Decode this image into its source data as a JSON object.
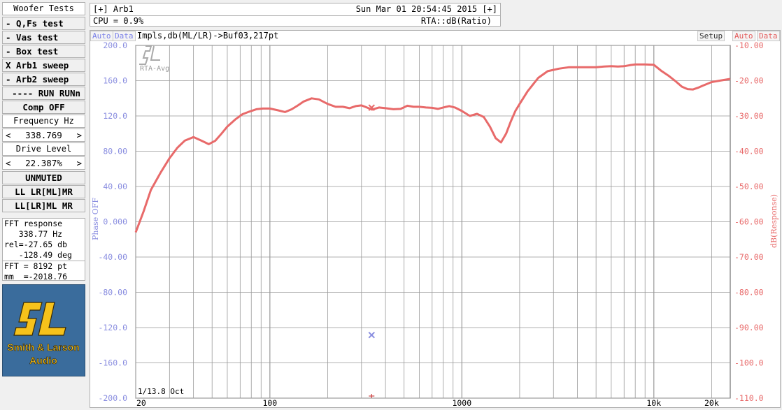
{
  "panel": {
    "title": "Woofer Tests",
    "buttons": [
      "- Q,Fs test",
      "- Vas test",
      "- Box test",
      "X Arb1 sweep",
      "- Arb2 sweep",
      "---- RUN RUNn",
      "Comp OFF"
    ],
    "frequency": {
      "label": "Frequency Hz",
      "left": "<",
      "value": "338.769",
      "right": ">"
    },
    "drive": {
      "label": "Drive Level",
      "left": "<",
      "value": "22.387%",
      "right": ">"
    },
    "mute": "UNMUTED",
    "chan1": "LL LR[ML]MR",
    "chan2": "LL[LR]ML MR"
  },
  "fft": {
    "line1": "FFT response",
    "line2": "   338.77 Hz",
    "line3": "rel=-27.65 db",
    "line4": "   -128.49 deg",
    "line5": "FFT = 8192 pt",
    "line6": "mm  =-2018.76"
  },
  "logo": {
    "mark": "SL",
    "line1": "Smith & Larson",
    "line2": "Audio"
  },
  "header": {
    "channel": "[+] Arb1",
    "datetime": "Sun Mar 01 20:54:45 2015 [+]",
    "cpu": "CPU = 0.9%",
    "mode": "RTA::dB(Ratio)"
  },
  "chart": {
    "left_auto": "Auto",
    "left_data": "Data",
    "right_auto": "Auto",
    "right_data": "Data",
    "setup": "Setup",
    "buffer_label": "Impls,db(ML/LR)->Buf03,217pt",
    "watermark": "RTA-Avg",
    "smoothing": "1/13.8 Oct",
    "left_axis_title": "Phase OFF",
    "right_axis_title": "dB(Response)",
    "colors": {
      "response": "#e86a6a",
      "phase_axis": "#8a8ee0",
      "grid": "#999999"
    }
  },
  "chart_data": {
    "type": "line",
    "x_scale": "log",
    "xlim": [
      20,
      25000
    ],
    "x_ticks": [
      20,
      100,
      1000,
      10000,
      20000
    ],
    "x_tick_labels": [
      "20",
      "100",
      "1000",
      "10k",
      "20k"
    ],
    "y_left": {
      "label": "Phase OFF",
      "lim": [
        -200,
        200
      ],
      "ticks": [
        "200.0",
        "160.0",
        "120.0",
        "80.00",
        "40.00",
        "0.000",
        "-40.00",
        "-80.00",
        "-120.0",
        "-160.0",
        "-200.0"
      ]
    },
    "y_right": {
      "label": "dB(Response)",
      "lim": [
        -110,
        -10
      ],
      "ticks": [
        "-10.00",
        "-20.00",
        "-30.00",
        "-40.00",
        "-50.00",
        "-60.00",
        "-70.00",
        "-80.00",
        "-90.00",
        "-100.0",
        "-110.0"
      ]
    },
    "series": [
      {
        "axis": "right",
        "color": "#e86a6a",
        "x": [
          20,
          22,
          24,
          27,
          30,
          33,
          36,
          40,
          44,
          48,
          52,
          56,
          60,
          66,
          72,
          78,
          85,
          92,
          100,
          110,
          120,
          130,
          140,
          150,
          165,
          180,
          200,
          220,
          240,
          260,
          280,
          300,
          320,
          340,
          370,
          400,
          440,
          480,
          520,
          560,
          600,
          650,
          700,
          750,
          800,
          860,
          920,
          1000,
          1100,
          1200,
          1300,
          1400,
          1500,
          1600,
          1700,
          1800,
          1900,
          2000,
          2200,
          2500,
          2800,
          3200,
          3600,
          4000,
          4500,
          5000,
          5500,
          6000,
          6500,
          7000,
          7500,
          8000,
          9000,
          10000,
          11000,
          12000,
          13000,
          14000,
          15000,
          16000,
          17000,
          18000,
          19000,
          20000,
          22000,
          25000
        ],
        "y": [
          -63,
          -57,
          -51,
          -46,
          -42,
          -39,
          -37,
          -36,
          -37,
          -38,
          -37,
          -35,
          -33,
          -31,
          -29.5,
          -28.8,
          -28.1,
          -27.9,
          -27.9,
          -28.4,
          -28.9,
          -28.1,
          -27,
          -25.9,
          -25,
          -25.3,
          -26.6,
          -27.4,
          -27.4,
          -27.8,
          -27.2,
          -27,
          -27.6,
          -28.2,
          -27.6,
          -27.8,
          -28.1,
          -28,
          -27.1,
          -27.4,
          -27.4,
          -27.6,
          -27.7,
          -28,
          -27.6,
          -27.2,
          -27.6,
          -28.6,
          -30,
          -29.4,
          -30.3,
          -33,
          -36.3,
          -37.5,
          -35,
          -31.5,
          -28.6,
          -26.6,
          -23,
          -19.2,
          -17.3,
          -16.6,
          -16.2,
          -16.2,
          -16.2,
          -16.2,
          -16,
          -15.9,
          -16,
          -15.9,
          -15.6,
          -15.4,
          -15.4,
          -15.5,
          -17.3,
          -18.7,
          -20.2,
          -21.7,
          -22.4,
          -22.5,
          -22,
          -21.4,
          -20.9,
          -20.4,
          -20,
          -19.5
        ]
      },
      {
        "axis": "marker",
        "color": "#e86a6a",
        "x": [
          338.77
        ],
        "y": [
          -27.65
        ],
        "symbol": "x"
      },
      {
        "axis": "marker",
        "color": "#8a8ee0",
        "x": [
          338.77
        ],
        "y": [
          -128.49
        ],
        "symbol": "x"
      }
    ]
  }
}
